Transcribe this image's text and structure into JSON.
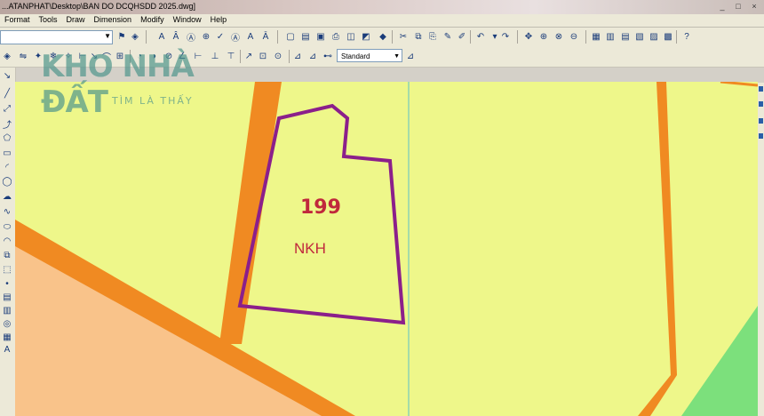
{
  "window": {
    "title": "...ATANPHAT\\Desktop\\BAN DO DCQHSDD 2025.dwg]",
    "controls": [
      "_",
      "□",
      "×"
    ]
  },
  "menu": [
    "Format",
    "Tools",
    "Draw",
    "Dimension",
    "Modify",
    "Window",
    "Help"
  ],
  "toolbar": {
    "layer_value": "",
    "text_style": "Standard"
  },
  "watermark": {
    "brand": "KHO NHÀ ĐẤT",
    "tagline": "TÌM LÀ THẤY"
  },
  "parcel": {
    "number": "199",
    "land_use_code": "NKH"
  },
  "colors": {
    "canvas_background": "#eef78a",
    "road": "#f08a22",
    "parcel_boundary": "#8b1f8b",
    "residential_zone": "#f9c38a",
    "green_zone": "#7ce07c",
    "label": "#c0283c"
  }
}
